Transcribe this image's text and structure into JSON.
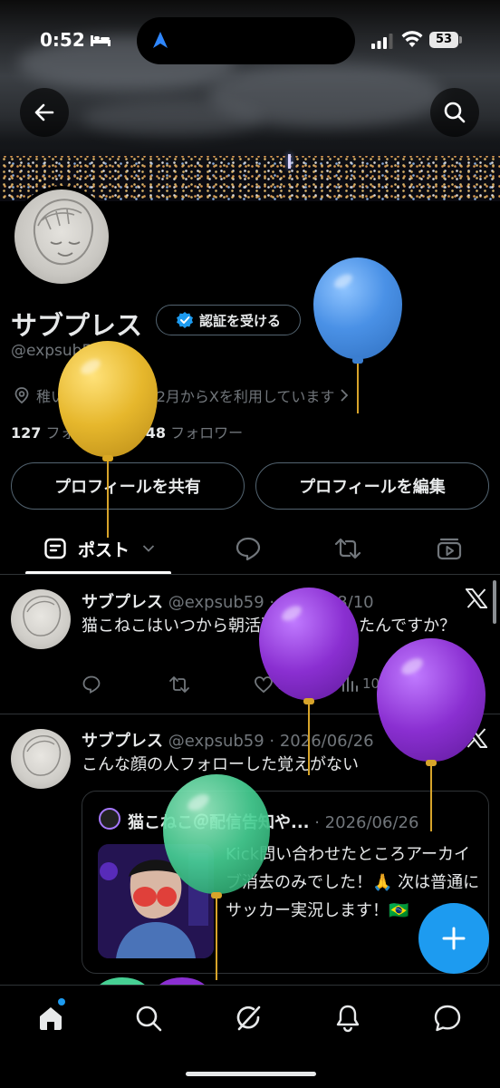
{
  "status_bar": {
    "time": "0:52",
    "battery": "53"
  },
  "profile": {
    "name": "サブプレス",
    "verify_label": "認証を受ける",
    "handle": "@expsub59",
    "location": "稚い",
    "joined": "2023年2月からXを利用しています",
    "following_count": "127",
    "following_label": "フォロー中",
    "followers_count": "48",
    "followers_label": "フォロワー",
    "share_label": "プロフィールを共有",
    "edit_label": "プロフィールを編集"
  },
  "tabs": {
    "posts_label": "ポスト"
  },
  "posts": [
    {
      "name": "サブプレス",
      "meta": "@expsub59 · 2026/08/10",
      "text": "猫こねこはいつから朝活配信者になったんですか？",
      "likes": "1",
      "views": "101"
    },
    {
      "name": "サブプレス",
      "meta": "@expsub59 · 2026/06/26",
      "text": "こんな顔の人フォローした覚えがない",
      "quote": {
        "name": "猫こねこ＠配信告知や...",
        "meta": " · 2026/06/26",
        "text": "Kick問い合わせたところアーカイブ消去のみでした！🙏 次は普通にサッカー実況します！🇧🇷"
      }
    }
  ],
  "colors": {
    "accent": "#1d9bf0",
    "balloon_yellow": "#e9bd2f",
    "balloon_blue": "#3f8be0",
    "balloon_purple": "#8a2fd1",
    "balloon_green": "#3fcf8e"
  }
}
